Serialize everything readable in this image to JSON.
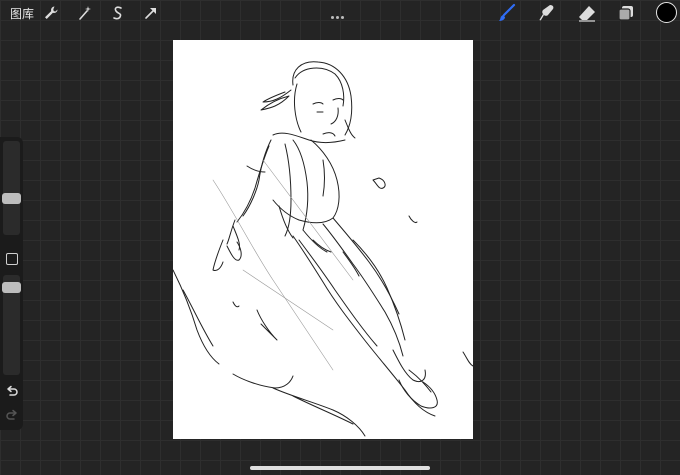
{
  "topbar": {
    "gallery_label": "图库",
    "left_tools": [
      "wrench-icon",
      "magic-wand-icon",
      "selection-icon",
      "transform-arrow-icon"
    ],
    "right_tools": [
      "brush-icon",
      "smudge-icon",
      "eraser-icon",
      "layers-icon"
    ],
    "active_tool": "brush-icon",
    "current_color": "#000000",
    "accent_color": "#2f6df6"
  },
  "sidebar": {
    "controls": [
      "brush-size-slider",
      "modify-button",
      "brush-opacity-slider",
      "undo-icon",
      "redo-icon"
    ]
  },
  "canvas": {
    "background": "#ffffff",
    "content": "sketch"
  }
}
